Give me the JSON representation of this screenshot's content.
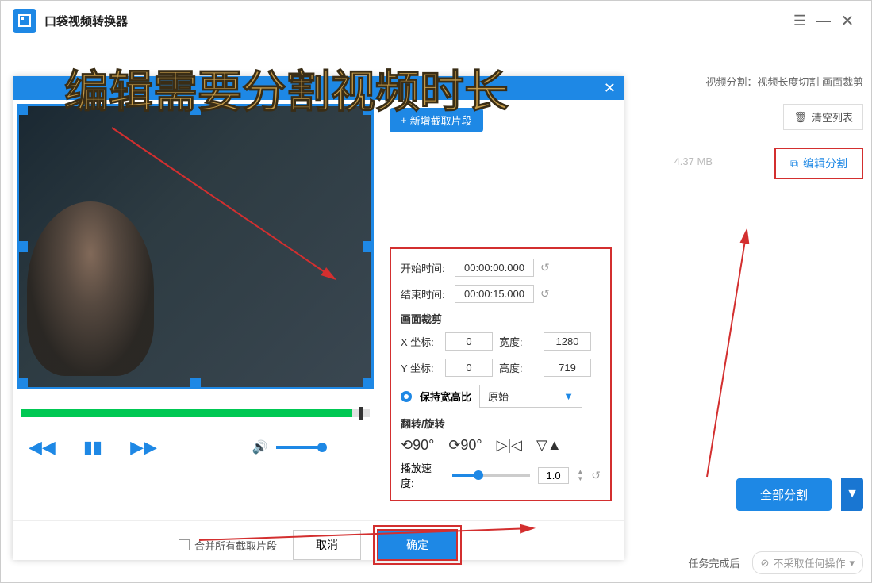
{
  "app": {
    "title": "口袋视频转换器"
  },
  "overlay_text": "编辑需要分割视频时长",
  "right_info": "视频分割：视频长度切割 画面裁剪",
  "clear_list_label": "清空列表",
  "edit_split_label": "编辑分割",
  "file_size": "4.37 MB",
  "split_all_label": "全部分割",
  "task_complete_label": "任务完成后",
  "no_action_label": "不采取任何操作",
  "dialog": {
    "add_segment": "新增截取片段",
    "start_time_label": "开始时间:",
    "start_time_value": "00:00:00.000",
    "end_time_label": "结束时间:",
    "end_time_value": "00:00:15.000",
    "crop_title": "画面裁剪",
    "x_label": "X 坐标:",
    "x_value": "0",
    "width_label": "宽度:",
    "width_value": "1280",
    "y_label": "Y 坐标:",
    "y_value": "0",
    "height_label": "高度:",
    "height_value": "719",
    "keep_ratio_label": "保持宽高比",
    "ratio_value": "原始",
    "flip_title": "翻转/旋转",
    "speed_label": "播放速度:",
    "speed_value": "1.0",
    "merge_label": "合并所有截取片段",
    "cancel": "取消",
    "confirm": "确定"
  }
}
